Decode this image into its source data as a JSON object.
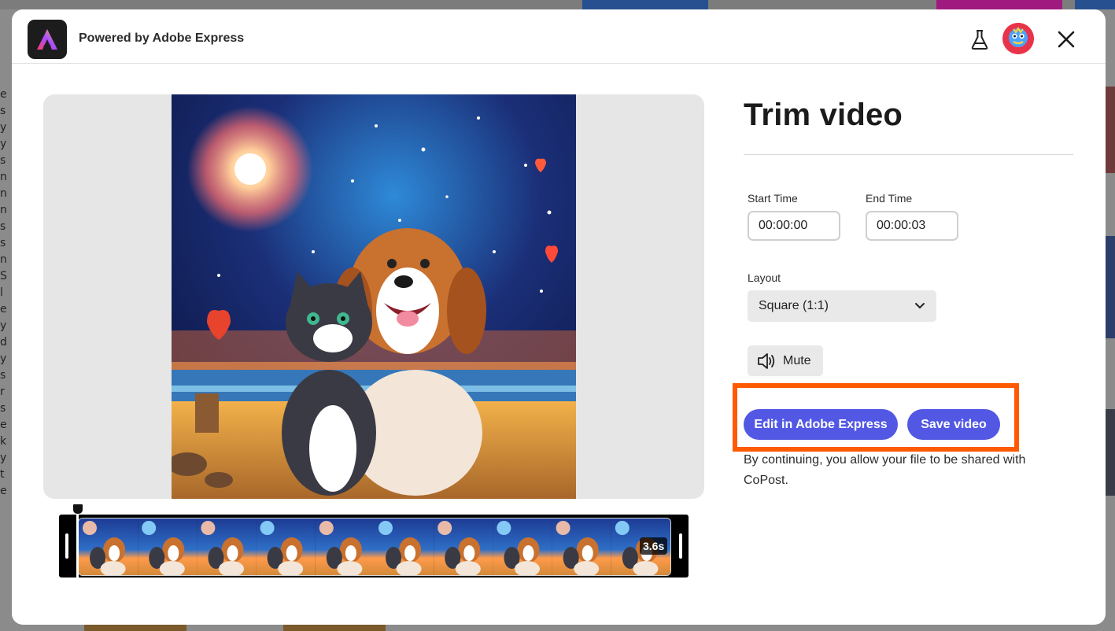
{
  "background_page": {
    "left_letters": [
      "e",
      "s",
      "y",
      "y",
      "s",
      "n",
      "n",
      "n",
      "s",
      "s",
      "n",
      "S",
      "l",
      "e",
      "y",
      "d",
      "y",
      "s",
      "r",
      "s",
      "e",
      "k",
      "y",
      "t",
      "e"
    ]
  },
  "header": {
    "title": "Powered by Adobe Express",
    "logo_icon": "adobe-express-logo-icon",
    "labs_icon": "flask-icon",
    "avatar_icon": "user-avatar",
    "close_icon": "close-icon"
  },
  "preview": {
    "image_description": "dog-and-cat-fireworks-illustration"
  },
  "timeline": {
    "duration": "3.6s",
    "frame_count": 10
  },
  "panel": {
    "title": "Trim video",
    "start_time_label": "Start Time",
    "start_time_value": "00:00:00",
    "end_time_label": "End Time",
    "end_time_value": "00:00:03",
    "layout_label": "Layout",
    "layout_value": "Square (1:1)",
    "mute_label": "Mute",
    "edit_button_label": "Edit in Adobe Express",
    "save_button_label": "Save video",
    "consent_text": "By continuing, you allow your file to be shared with CoPost."
  },
  "colors": {
    "primary": "#5258e4",
    "highlight": "#ff5a00"
  }
}
